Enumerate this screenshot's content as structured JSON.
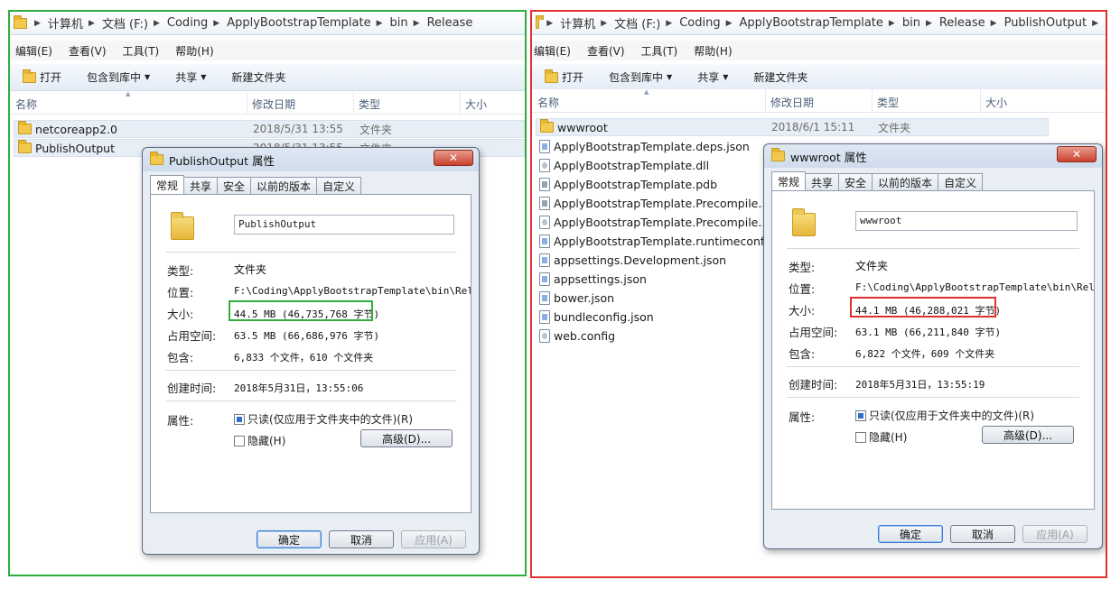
{
  "left": {
    "breadcrumb": [
      "计算机",
      "文档 (F:)",
      "Coding",
      "ApplyBootstrapTemplate",
      "bin",
      "Release"
    ],
    "menu": [
      "编辑(E)",
      "查看(V)",
      "工具(T)",
      "帮助(H)"
    ],
    "toolbar": {
      "open": "打开",
      "include": "包含到库中",
      "share": "共享",
      "new_folder": "新建文件夹"
    },
    "columns": {
      "name": "名称",
      "date": "修改日期",
      "type": "类型",
      "size": "大小"
    },
    "files": [
      {
        "name": "netcoreapp2.0",
        "date": "2018/5/31 13:55",
        "type": "文件夹"
      },
      {
        "name": "PublishOutput",
        "date": "2018/5/31 13:55",
        "type": "文件夹"
      }
    ],
    "dialog": {
      "title": "PublishOutput 属性",
      "close": "✕",
      "tabs": [
        "常规",
        "共享",
        "安全",
        "以前的版本",
        "自定义"
      ],
      "name": "PublishOutput",
      "type_label": "类型:",
      "type_value": "文件夹",
      "location_label": "位置:",
      "location_value": "F:\\Coding\\ApplyBootstrapTemplate\\bin\\Rele",
      "size_label": "大小:",
      "size_value": "44.5 MB (46,735,768 字节)",
      "disk_label": "占用空间:",
      "disk_value": "63.5 MB (66,686,976 字节)",
      "contains_label": "包含:",
      "contains_value": "6,833 个文件，610 个文件夹",
      "created_label": "创建时间:",
      "created_value": "2018年5月31日，13:55:06",
      "attr_label": "属性:",
      "readonly": "只读(仅应用于文件夹中的文件)(R)",
      "hidden": "隐藏(H)",
      "advanced": "高级(D)...",
      "ok": "确定",
      "cancel": "取消",
      "apply": "应用(A)"
    }
  },
  "right": {
    "breadcrumb": [
      "计算机",
      "文档 (F:)",
      "Coding",
      "ApplyBootstrapTemplate",
      "bin",
      "Release",
      "PublishOutput"
    ],
    "menu": [
      "编辑(E)",
      "查看(V)",
      "工具(T)",
      "帮助(H)"
    ],
    "toolbar": {
      "open": "打开",
      "include": "包含到库中",
      "share": "共享",
      "new_folder": "新建文件夹"
    },
    "columns": {
      "name": "名称",
      "date": "修改日期",
      "type": "类型",
      "size": "大小"
    },
    "folder_row": {
      "name": "wwwroot",
      "date": "2018/6/1 15:11",
      "type": "文件夹"
    },
    "files": [
      {
        "name": "ApplyBootstrapTemplate.deps.json",
        "icon": "json-file-icon"
      },
      {
        "name": "ApplyBootstrapTemplate.dll",
        "icon": "dll-file-icon"
      },
      {
        "name": "ApplyBootstrapTemplate.pdb",
        "icon": "pdb-file-icon"
      },
      {
        "name": "ApplyBootstrapTemplate.Precompile...",
        "icon": "pdb-file-icon"
      },
      {
        "name": "ApplyBootstrapTemplate.Precompile...",
        "icon": "dll-file-icon"
      },
      {
        "name": "ApplyBootstrapTemplate.runtimeconf...",
        "icon": "json-file-icon"
      },
      {
        "name": "appsettings.Development.json",
        "icon": "json-file-icon"
      },
      {
        "name": "appsettings.json",
        "icon": "json-file-icon"
      },
      {
        "name": "bower.json",
        "icon": "json-file-icon"
      },
      {
        "name": "bundleconfig.json",
        "icon": "json-file-icon"
      },
      {
        "name": "web.config",
        "icon": "config-file-icon"
      }
    ],
    "dialog": {
      "title": "wwwroot 属性",
      "close": "✕",
      "tabs": [
        "常规",
        "共享",
        "安全",
        "以前的版本",
        "自定义"
      ],
      "name": "wwwroot",
      "type_label": "类型:",
      "type_value": "文件夹",
      "location_label": "位置:",
      "location_value": "F:\\Coding\\ApplyBootstrapTemplate\\bin\\Rele",
      "size_label": "大小:",
      "size_value": "44.1 MB (46,288,021 字节)",
      "disk_label": "占用空间:",
      "disk_value": "63.1 MB (66,211,840 字节)",
      "contains_label": "包含:",
      "contains_value": "6,822 个文件，609 个文件夹",
      "created_label": "创建时间:",
      "created_value": "2018年5月31日，13:55:19",
      "attr_label": "属性:",
      "readonly": "只读(仅应用于文件夹中的文件)(R)",
      "hidden": "隐藏(H)",
      "advanced": "高级(D)...",
      "ok": "确定",
      "cancel": "取消",
      "apply": "应用(A)"
    }
  }
}
